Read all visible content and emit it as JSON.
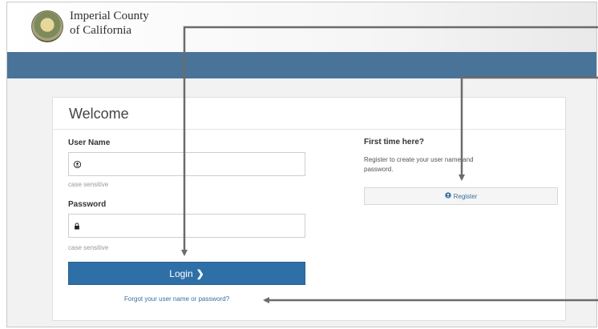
{
  "header": {
    "org_line1": "Imperial County",
    "org_line2": "of California"
  },
  "login_card": {
    "title": "Welcome",
    "username": {
      "label": "User Name",
      "value": "",
      "icon": "user-icon",
      "hint": "case sensitive"
    },
    "password": {
      "label": "Password",
      "value": "",
      "icon": "lock-icon",
      "hint": "case sensitive"
    },
    "login_button": {
      "label": "Login",
      "icon": "chevron-right-icon",
      "glyph": "❯"
    },
    "forgot_link": "Forgot your user name or password?"
  },
  "register_panel": {
    "heading": "First time here?",
    "text": "Register to create your user name and password.",
    "button": {
      "label": "Register",
      "icon": "user-icon"
    }
  },
  "colors": {
    "navbar": "#4a7399",
    "primary_button": "#2f6fa7",
    "link": "#3a6f9e",
    "annotation_arrow": "#6b6b6b"
  }
}
